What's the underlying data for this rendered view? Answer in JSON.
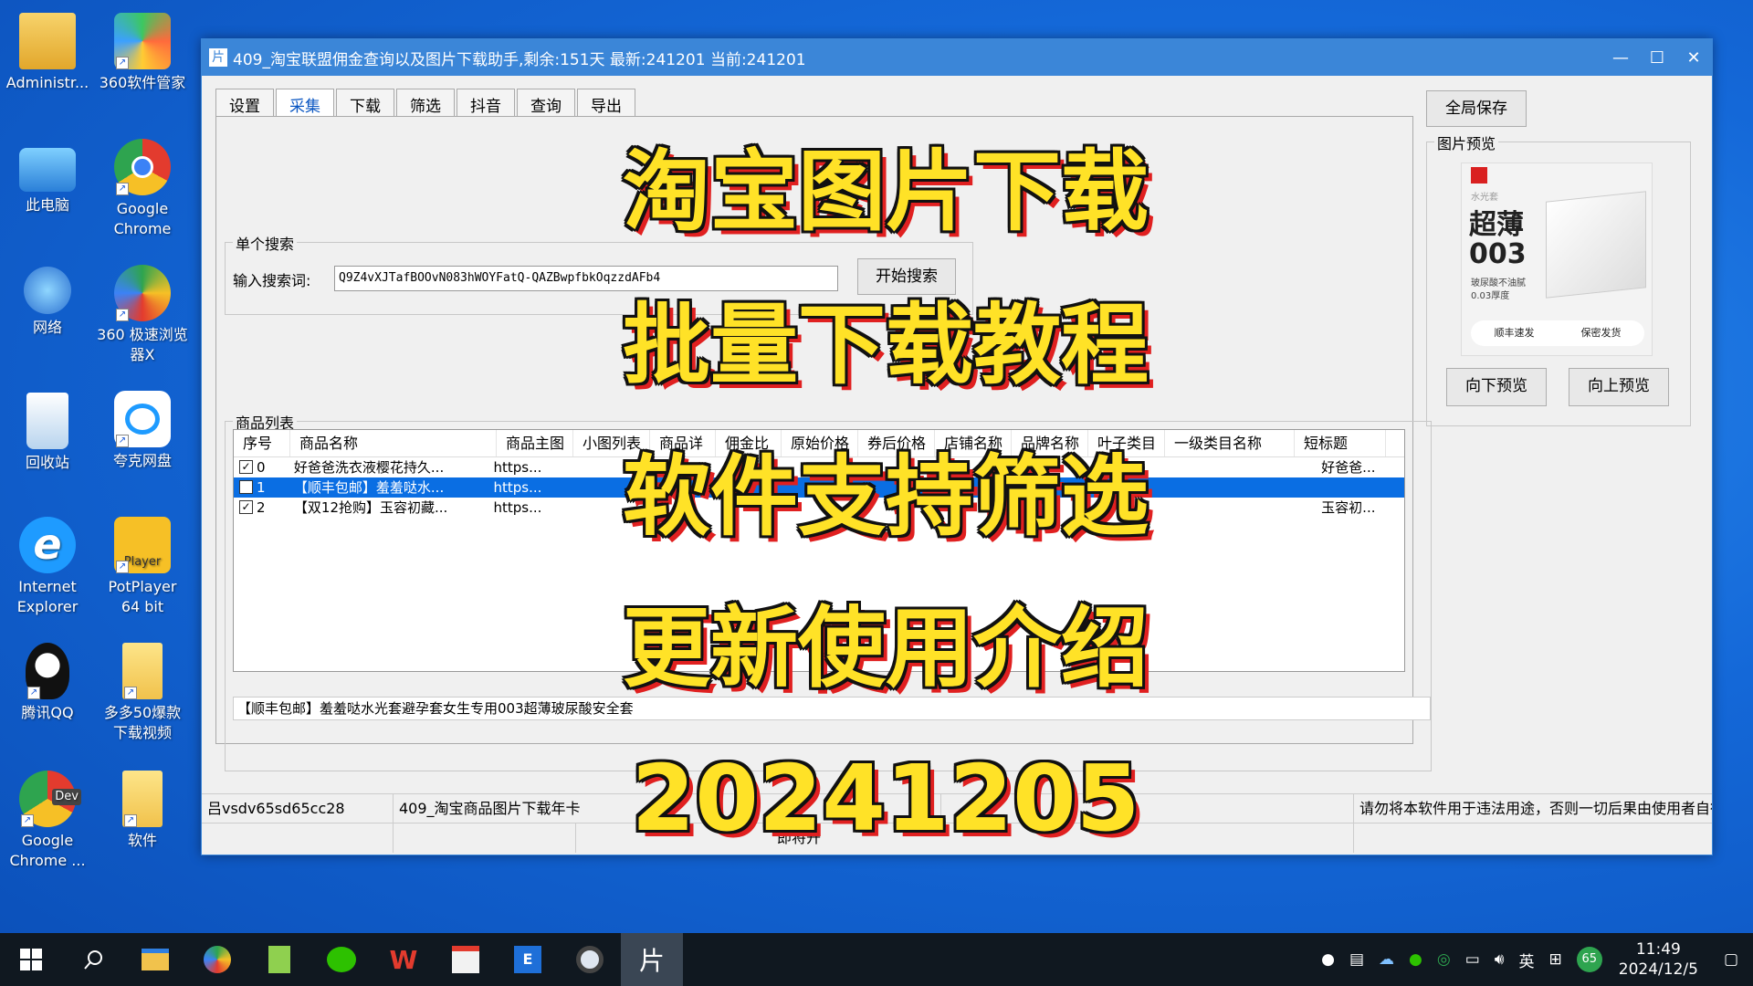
{
  "desktop_icons": [
    {
      "label": "Administr...",
      "icon": "user-folder-icon"
    },
    {
      "label": "360软件管家",
      "icon": "360-manager-icon"
    },
    {
      "label": "此电脑",
      "icon": "computer-icon"
    },
    {
      "label": "Google Chrome",
      "icon": "chrome-icon"
    },
    {
      "label": "网络",
      "icon": "network-icon"
    },
    {
      "label": "360 极速浏览器X",
      "icon": "360-browser-icon"
    },
    {
      "label": "回收站",
      "icon": "recycle-bin-icon"
    },
    {
      "label": "夸克网盘",
      "icon": "quark-cloud-icon"
    },
    {
      "label": "Internet Explorer",
      "icon": "ie-icon"
    },
    {
      "label": "PotPlayer 64 bit",
      "icon": "potplayer-icon"
    },
    {
      "label": "腾讯QQ",
      "icon": "qq-icon"
    },
    {
      "label": "多多50爆款下载视频",
      "icon": "folder-icon"
    },
    {
      "label": "Google Chrome ...",
      "icon": "chrome-dev-icon"
    },
    {
      "label": "软件",
      "icon": "folder-icon"
    }
  ],
  "window": {
    "title": "409_淘宝联盟佣金查询以及图片下载助手,剩余:151天 最新:241201 当前:241201",
    "app_icon_glyph": "片"
  },
  "tabs": [
    "设置",
    "采集",
    "下载",
    "筛选",
    "抖音",
    "查询",
    "导出"
  ],
  "active_tab": "采集",
  "global_save": "全局保存",
  "single_search": {
    "group_label": "单个搜索",
    "input_label": "输入搜索词:",
    "input_value": "Q9Z4vXJTafBOOvN083hWOYFatQ-QAZBwpfbkOqzzdAFb4",
    "search_button": "开始搜索"
  },
  "product_list": {
    "group_label": "商品列表",
    "columns": [
      "序号",
      "商品名称",
      "商品主图",
      "小图列表",
      "商品详",
      "佣金比",
      "原始价格",
      "券后价格",
      "店铺名称",
      "品牌名称",
      "叶子类目",
      "一级类目名称",
      "短标题"
    ],
    "rows": [
      {
        "checked": true,
        "index": "0",
        "name": "好爸爸洗衣液樱花持久...",
        "image": "https...",
        "short_title": "好爸爸...",
        "selected": false
      },
      {
        "checked": false,
        "index": "1",
        "name": "【顺丰包邮】羞羞哒水...",
        "image": "https...",
        "short_title": "",
        "selected": true
      },
      {
        "checked": true,
        "index": "2",
        "name": "【双12抢购】玉容初藏...",
        "image": "https...",
        "short_title": "玉容初...",
        "selected": false
      }
    ],
    "detail_text": "【顺丰包邮】羞羞哒水光套避孕套女生专用003超薄玻尿酸安全套"
  },
  "preview": {
    "group_label": "图片预览",
    "image_text_big": "超薄",
    "image_text_num": "003",
    "image_text_small1": "玻尿酸不油腻",
    "image_text_small2": "0.03厚度",
    "image_badge1": "顺丰速发",
    "image_badge2": "保密发货",
    "image_brand": "水光套",
    "prev_button": "向下预览",
    "next_button": "向上预览"
  },
  "status_bar": {
    "user_id": "吕vsdv65sd65cc28",
    "product": "409_淘宝商品图片下载年卡",
    "disclaimer": "请勿将本软件用于违法用途，否则一切后果由使用者自行承担",
    "row2_text": "即将开"
  },
  "overlay_text": [
    "淘宝图片下载",
    "批量下载教程",
    "软件支持筛选",
    "更新使用介绍",
    "20241205"
  ],
  "taskbar": {
    "time": "11:49",
    "date": "2024/12/5",
    "ime": "英",
    "badge": "65"
  },
  "colors": {
    "desktop": "#1468d8",
    "titlebar": "#3b86d8",
    "selection": "#0a6ee3",
    "overlay_fill": "#ffe227",
    "overlay_shadow": "#e02020"
  }
}
